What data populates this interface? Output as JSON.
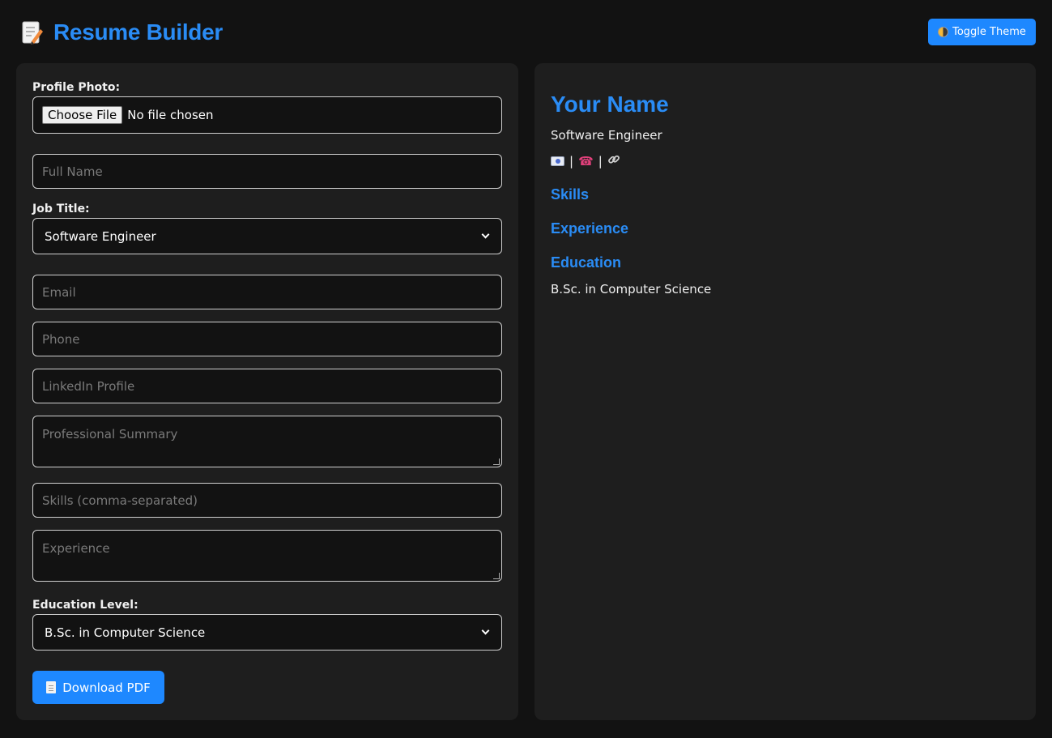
{
  "header": {
    "title": "Resume Builder",
    "logo_icon": "memo-icon",
    "theme_button_label": "Toggle Theme"
  },
  "form": {
    "photo_label": "Profile Photo:",
    "file_button_label": "Choose File",
    "file_status": "No file chosen",
    "full_name_placeholder": "Full Name",
    "job_title_label": "Job Title:",
    "job_title_value": "Software Engineer",
    "email_placeholder": "Email",
    "phone_placeholder": "Phone",
    "linkedin_placeholder": "LinkedIn Profile",
    "summary_placeholder": "Professional Summary",
    "skills_placeholder": "Skills (comma-separated)",
    "experience_placeholder": "Experience",
    "education_label": "Education Level:",
    "education_value": "B.Sc. in Computer Science",
    "download_label": "Download PDF"
  },
  "preview": {
    "name": "Your Name",
    "job_title": "Software Engineer",
    "contact_separator": "|",
    "skills_heading": "Skills",
    "experience_heading": "Experience",
    "education_heading": "Education",
    "education_value": "B.Sc. in Computer Science"
  },
  "colors": {
    "accent": "#1e88ff",
    "heading": "#2a8cf5",
    "background": "#121212",
    "panel": "#1e1e1e"
  }
}
